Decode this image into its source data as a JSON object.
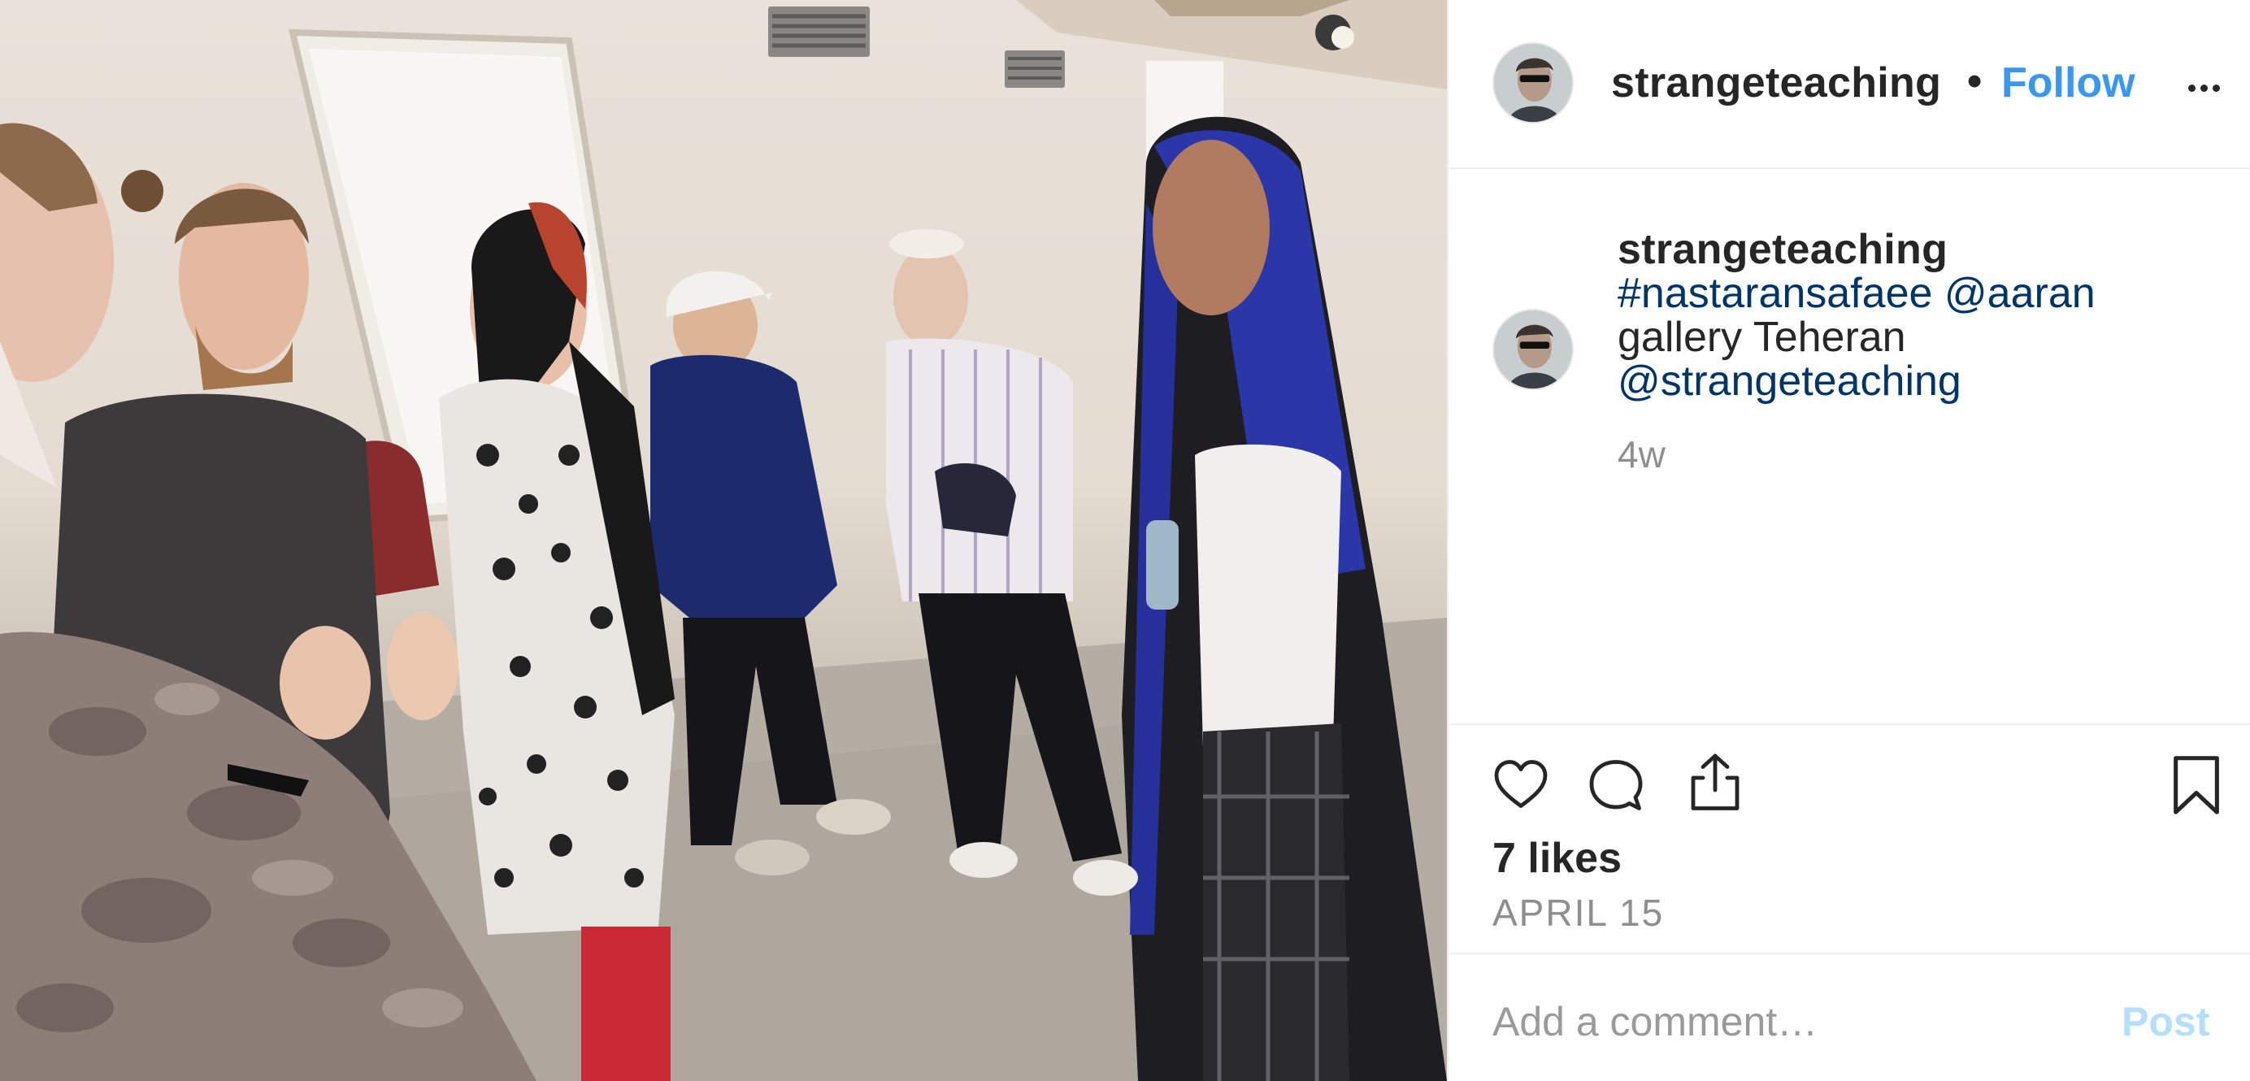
{
  "post": {
    "image": {
      "description_icon": "photo-image"
    }
  },
  "header": {
    "username": "strangeteaching",
    "separator": "•",
    "follow_label": "Follow",
    "more_icon": "ellipsis-icon"
  },
  "caption": {
    "username": "strangeteaching",
    "hashtag": "#nastaransafaee",
    "mention1": "@aaran",
    "text": "gallery Teheran",
    "mention2": "@strangeteaching",
    "time": "4w"
  },
  "actions": {
    "like_icon": "heart-icon",
    "comment_icon": "comment-icon",
    "share_icon": "share-icon",
    "save_icon": "bookmark-icon"
  },
  "likes": "7 likes",
  "date": "APRIL 15",
  "comment": {
    "placeholder": "Add a comment…",
    "post_label": "Post"
  },
  "colors": {
    "link_blue": "#3897f0",
    "mention_dark_blue": "#003569",
    "post_disabled": "#b2dffc",
    "text": "#262626",
    "muted": "#8e8e8e"
  }
}
